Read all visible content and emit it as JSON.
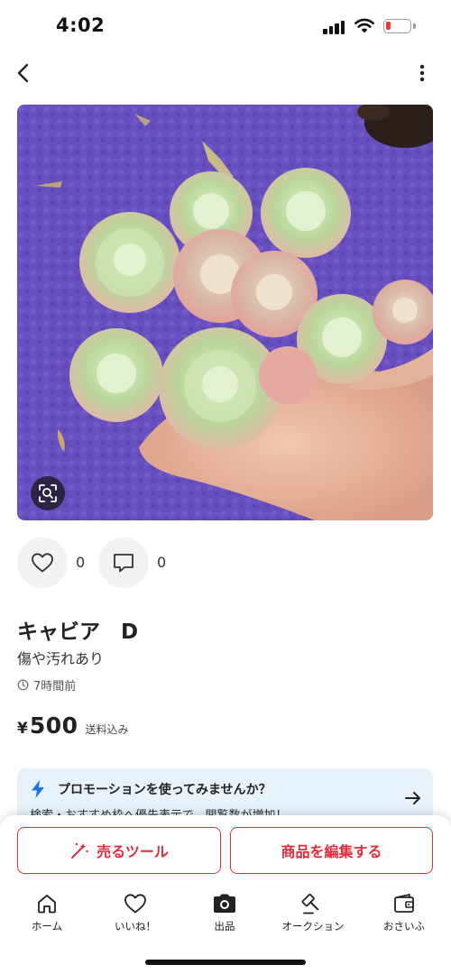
{
  "status_bar": {
    "time": "4:02"
  },
  "nav": {
    "back_icon": "chevron-left-icon",
    "more_icon": "kebab-menu-icon"
  },
  "photo": {
    "subject": "succulent-cluster-on-purple-mat",
    "zoom_icon": "image-search-icon"
  },
  "actions": {
    "like_count": "0",
    "comment_count": "0"
  },
  "item": {
    "title": "キャビア　D",
    "condition": "傷や汚れあり",
    "posted": "7時間前",
    "currency": "¥",
    "price": "500",
    "shipping": "送料込み"
  },
  "promo": {
    "title": "プロモーションを使ってみませんか？",
    "subtitle": "検索・おすすめ枠へ優先表示で、閲覧数が増加！",
    "accent": "#1a73e8"
  },
  "buttons": {
    "sell_tool": "売るツール",
    "edit_item": "商品を編集する",
    "color": "#e02d3c"
  },
  "tabs": [
    {
      "label": "ホーム",
      "icon": "home-icon"
    },
    {
      "label": "いいね！",
      "icon": "heart-icon"
    },
    {
      "label": "出品",
      "icon": "camera-icon"
    },
    {
      "label": "オークション",
      "icon": "gavel-icon"
    },
    {
      "label": "おさいふ",
      "icon": "wallet-icon"
    }
  ]
}
